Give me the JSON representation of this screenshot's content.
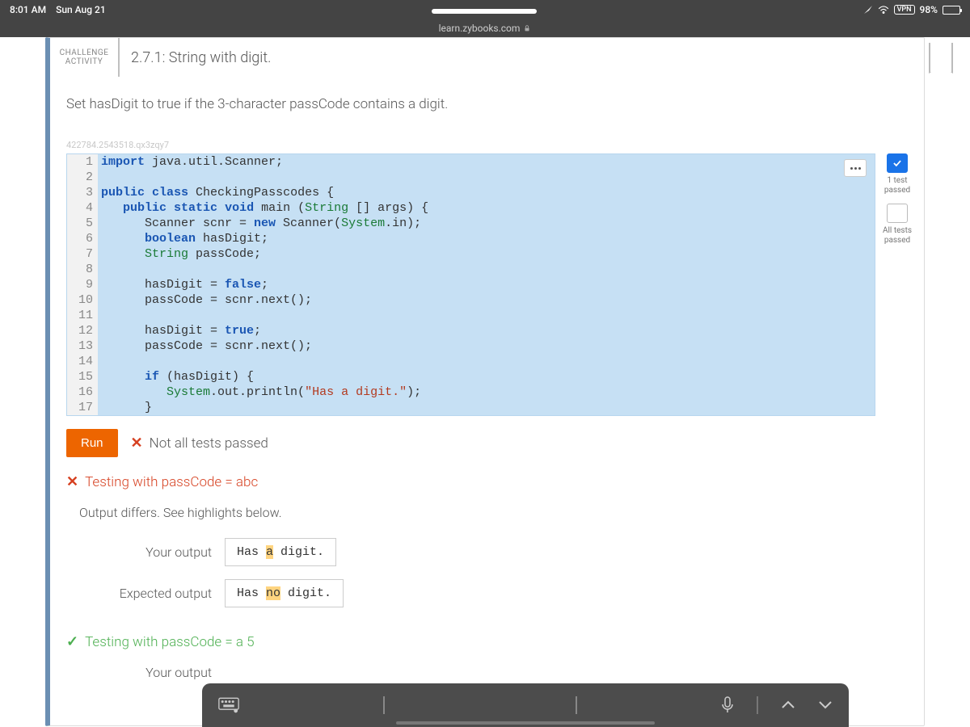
{
  "status_bar": {
    "time": "8:01 AM",
    "date": "Sun Aug 21",
    "vpn": "VPN",
    "battery": "98%"
  },
  "url": "learn.zybooks.com",
  "challenge": {
    "tag_line1": "CHALLENGE",
    "tag_line2": "ACTIVITY",
    "title": "2.7.1: String with digit."
  },
  "instruction": "Set hasDigit to true if the 3-character passCode contains a digit.",
  "watermark": "422784.2543518.qx3zqy7",
  "code_lines": [
    {
      "n": "1"
    },
    {
      "n": "2"
    },
    {
      "n": "3"
    },
    {
      "n": "4"
    },
    {
      "n": "5"
    },
    {
      "n": "6"
    },
    {
      "n": "7"
    },
    {
      "n": "8"
    },
    {
      "n": "9"
    },
    {
      "n": "10"
    },
    {
      "n": "11"
    },
    {
      "n": "12"
    },
    {
      "n": "13"
    },
    {
      "n": "14"
    },
    {
      "n": "15"
    },
    {
      "n": "16"
    },
    {
      "n": "17"
    }
  ],
  "test_status": {
    "t1_line1": "1 test",
    "t1_line2": "passed",
    "t2_line1": "All tests",
    "t2_line2": "passed"
  },
  "run": {
    "button": "Run",
    "message": "Not all tests passed"
  },
  "test1": {
    "heading": "Testing with passCode = abc",
    "diff_msg": "Output differs. See highlights below.",
    "your_label": "Your output",
    "your_pre": "Has ",
    "your_hl": "a",
    "your_post": " digit.",
    "exp_label": "Expected output",
    "exp_pre": "Has ",
    "exp_hl": "no",
    "exp_post": " digit."
  },
  "test2": {
    "heading": "Testing with passCode = a 5",
    "your_label": "Your output"
  }
}
